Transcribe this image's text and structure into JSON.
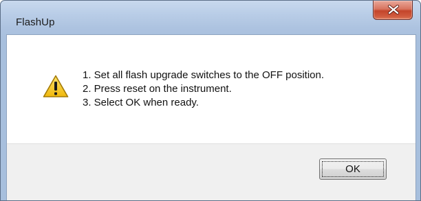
{
  "window": {
    "title": "FlashUp"
  },
  "titlebar": {
    "close_icon": "close-x-icon"
  },
  "dialog": {
    "icon": "warning-icon",
    "messages": [
      "1. Set all flash upgrade switches to the OFF position.",
      "2. Press reset on the instrument.",
      "3. Select OK when ready."
    ]
  },
  "buttons": {
    "ok_label": "OK"
  },
  "colors": {
    "titlebar": "#b9cde7",
    "close_button": "#c4452b",
    "button_bar": "#f0f0f0",
    "warning_yellow": "#f5c518"
  }
}
